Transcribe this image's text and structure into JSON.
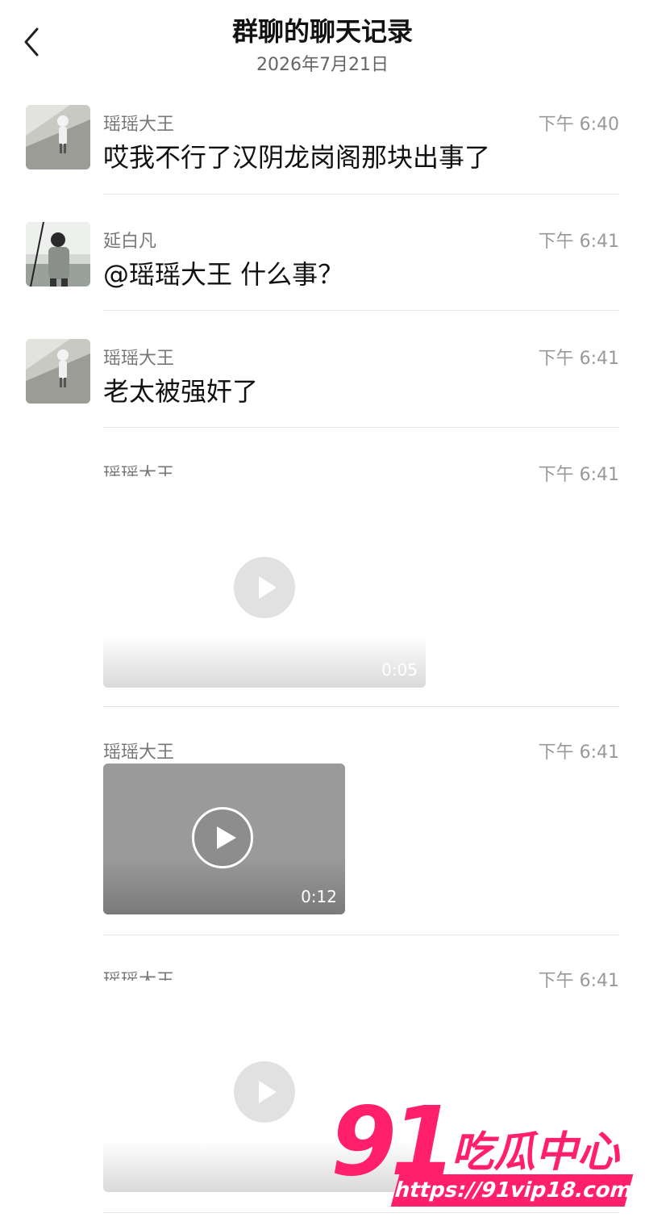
{
  "header": {
    "title": "群聊的聊天记录",
    "date": "2026年7月21日"
  },
  "messages": [
    {
      "sender": "瑶瑶大王",
      "time": "下午 6:40",
      "text": "哎我不行了汉阴龙岗阁那块出事了"
    },
    {
      "sender": "延白凡",
      "time": "下午 6:41",
      "text": "@瑶瑶大王 什么事？"
    },
    {
      "sender": "瑶瑶大王",
      "time": "下午 6:41",
      "text": "老太被强奸了"
    },
    {
      "sender": "瑶瑶大王",
      "time": "下午 6:41",
      "video_duration": "0:05"
    },
    {
      "sender": "瑶瑶大王",
      "time": "下午 6:41",
      "video_duration": "0:12"
    },
    {
      "sender": "瑶瑶大王",
      "time": "下午 6:41",
      "video_duration": ""
    }
  ],
  "watermark": {
    "logo_number": "91",
    "logo_text": "吃瓜中心",
    "url": "https://91vip18.com"
  },
  "icons": {
    "back": "chevron-left-icon",
    "play": "play-icon"
  },
  "colors": {
    "accent": "#ff1f6b",
    "divider": "#e6e6e6"
  }
}
